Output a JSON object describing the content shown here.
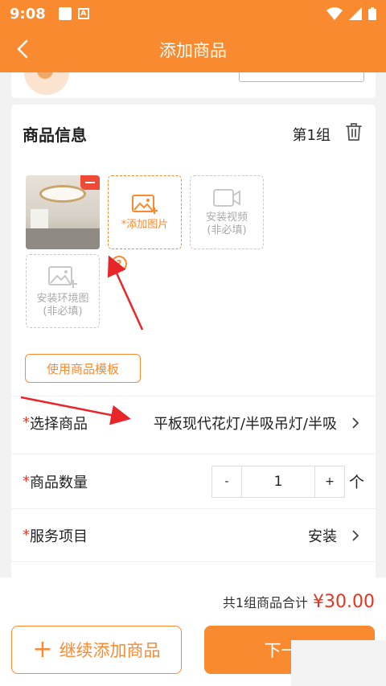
{
  "statusbar": {
    "time": "9:08"
  },
  "nav": {
    "title": "添加商品"
  },
  "card": {
    "title": "商品信息",
    "group": "第1组",
    "tiles": {
      "add_image": "*添加图片",
      "install_video": [
        "安装视频",
        "(非必填)"
      ],
      "install_env": [
        "安装环境图",
        "(非必填)"
      ]
    },
    "template_button": "使用商品模板",
    "rows": {
      "product": {
        "required": "*",
        "label": "选择商品",
        "value": "平板现代花灯/半吸吊灯/半吸"
      },
      "quantity": {
        "required": "*",
        "label": "商品数量",
        "minus": "-",
        "value": "1",
        "plus": "+",
        "unit": "个"
      },
      "service": {
        "required": "*",
        "label": "服务项目",
        "value": "安装"
      }
    }
  },
  "footer": {
    "total_label": "共1组商品合计",
    "total_value": "¥30.00",
    "add_more": "继续添加商品",
    "add_more_plus": "+",
    "next": "下一步"
  },
  "colors": {
    "accent": "#f98a2f",
    "price": "#e8341f",
    "required": "#e83a2a"
  }
}
